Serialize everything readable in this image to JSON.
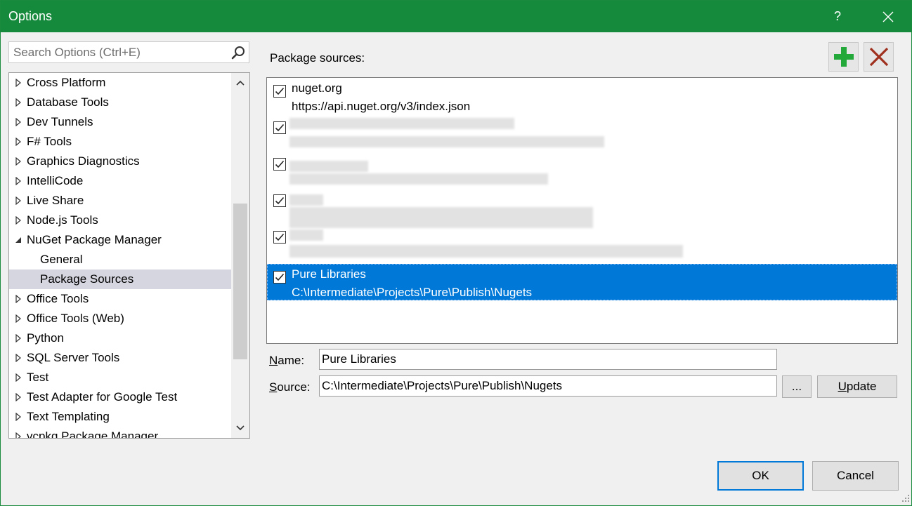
{
  "window": {
    "title": "Options",
    "help": "?"
  },
  "search": {
    "placeholder": "Search Options (Ctrl+E)"
  },
  "tree": {
    "items": [
      {
        "label": "Cross Platform"
      },
      {
        "label": "Database Tools"
      },
      {
        "label": "Dev Tunnels"
      },
      {
        "label": "F# Tools"
      },
      {
        "label": "Graphics Diagnostics"
      },
      {
        "label": "IntelliCode"
      },
      {
        "label": "Live Share"
      },
      {
        "label": "Node.js Tools"
      },
      {
        "label": "NuGet Package Manager",
        "expanded": true
      },
      {
        "label": "General"
      },
      {
        "label": "Package Sources",
        "selected": true
      },
      {
        "label": "Office Tools"
      },
      {
        "label": "Office Tools (Web)"
      },
      {
        "label": "Python"
      },
      {
        "label": "SQL Server Tools"
      },
      {
        "label": "Test"
      },
      {
        "label": "Test Adapter for Google Test"
      },
      {
        "label": "Text Templating"
      },
      {
        "label": "vcpkg Package Manager"
      }
    ]
  },
  "package_sources": {
    "label": "Package sources:",
    "sources": [
      {
        "name": "nuget.org",
        "url": "https://api.nuget.org/v3/index.json",
        "checked": true
      },
      {
        "name": "",
        "url": "",
        "checked": true,
        "redacted": true
      },
      {
        "name": "",
        "url": "",
        "checked": true,
        "redacted": true
      },
      {
        "name": "",
        "url": "",
        "checked": true,
        "redacted": true
      },
      {
        "name": "",
        "url": "",
        "checked": true,
        "redacted": true
      },
      {
        "name": "Pure Libraries",
        "url": "C:\\Intermediate\\Projects\\Pure\\Publish\\Nugets",
        "checked": true,
        "selected": true
      }
    ]
  },
  "form": {
    "name_label_u": "N",
    "name_label_rest": "ame:",
    "name_value": "Pure Libraries",
    "source_label_u": "S",
    "source_label_rest": "ource:",
    "source_value": "C:\\Intermediate\\Projects\\Pure\\Publish\\Nugets",
    "browse_label": "...",
    "update_label_u": "U",
    "update_label_rest": "pdate"
  },
  "footer": {
    "ok_label": "OK",
    "cancel_label": "Cancel"
  },
  "colors": {
    "titlebar": "#168a3c",
    "selection": "#0078d7",
    "add_icon": "#22a93a",
    "remove_icon": "#a0301e"
  },
  "icons": {
    "add": "plus-icon",
    "remove": "x-icon",
    "search": "search-icon"
  }
}
